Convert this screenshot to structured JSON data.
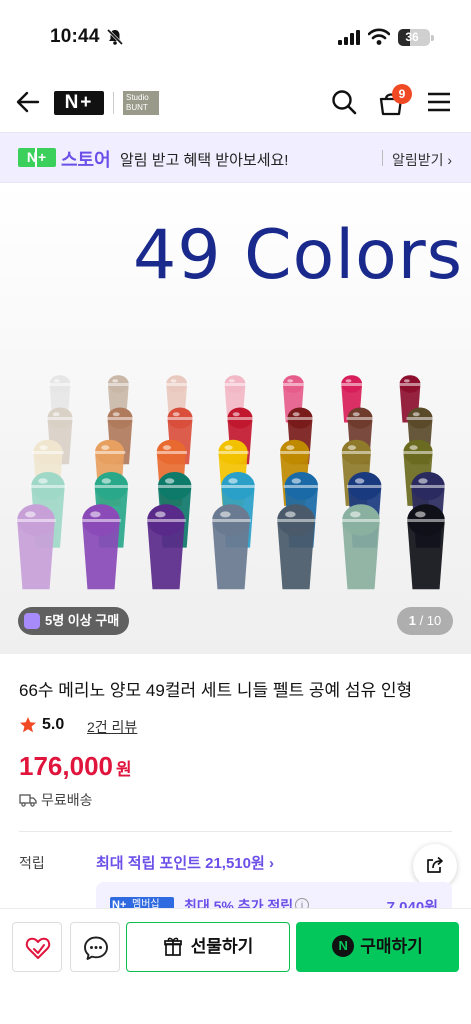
{
  "status_bar": {
    "time": "10:44",
    "battery": "36",
    "battery_level": 0.36
  },
  "nav": {
    "logo": "N+",
    "studio_line1": "Studio",
    "studio_line2": "BUNT",
    "cart_count": "9"
  },
  "promo": {
    "badge": "N+",
    "store": "스토어",
    "message": "알림 받고 혜택 받아보세요!",
    "cta": "알림받기 ›"
  },
  "hero": {
    "headline": "49 Colors",
    "purchase_badge": "5명 이상 구매",
    "page_current": "1",
    "page_total": " / 10"
  },
  "product": {
    "title": "66수 메리노 양모 49컬러 세트 니들 펠트 공예 섬유 인형",
    "rating": "5.0",
    "reviews": "2건 리뷰",
    "price": "176,000",
    "currency": "원",
    "shipping": "무료배송"
  },
  "points": {
    "label": "적립",
    "max": "최대 적립 포인트 21,510원 ›",
    "membership_badge": "멤버십",
    "extra": "최대 5% 추가 적립",
    "extra_amount": "7,040원"
  },
  "bottom_bar": {
    "gift": "선물하기",
    "buy": "구매하기"
  },
  "colors": {
    "accent_purple": "#6b4fe8",
    "naver_green": "#03c75a",
    "price_red": "#e0143c",
    "headline_blue": "#1a2a8c",
    "cart_badge": "#f04a24"
  },
  "icons": [
    "back-icon",
    "search-icon",
    "cart-icon",
    "menu-icon",
    "star-icon",
    "truck-icon",
    "share-icon",
    "heart-icon",
    "chat-icon",
    "gift-icon"
  ]
}
